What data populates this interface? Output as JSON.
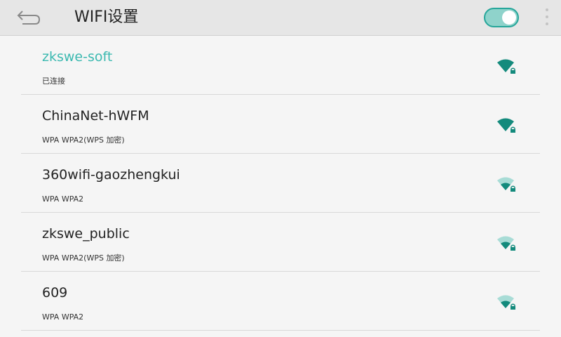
{
  "header": {
    "title": "WIFI设置",
    "back_icon": "back-arrow-icon",
    "wifi_toggle_on": true,
    "more_icon": "more-vertical-icon"
  },
  "colors": {
    "accent": "#26a69a",
    "connected_text": "#3bb9b0",
    "signal_strong": "#138a7c",
    "signal_weak_fill": "#a8dcd6"
  },
  "networks": [
    {
      "ssid": "zkswe-soft",
      "status": "已连接",
      "connected": true,
      "signal_level": 4,
      "locked": true,
      "icon": "wifi-locked-icon"
    },
    {
      "ssid": "ChinaNet-hWFM",
      "status": "WPA WPA2(WPS 加密)",
      "connected": false,
      "signal_level": 4,
      "locked": true,
      "icon": "wifi-locked-icon"
    },
    {
      "ssid": "360wifi-gaozhengkui",
      "status": "WPA WPA2",
      "connected": false,
      "signal_level": 2,
      "locked": true,
      "icon": "wifi-locked-icon"
    },
    {
      "ssid": "zkswe_public",
      "status": "WPA WPA2(WPS 加密)",
      "connected": false,
      "signal_level": 2,
      "locked": true,
      "icon": "wifi-locked-icon"
    },
    {
      "ssid": "609",
      "status": "WPA WPA2",
      "connected": false,
      "signal_level": 2,
      "locked": true,
      "icon": "wifi-locked-icon"
    }
  ]
}
